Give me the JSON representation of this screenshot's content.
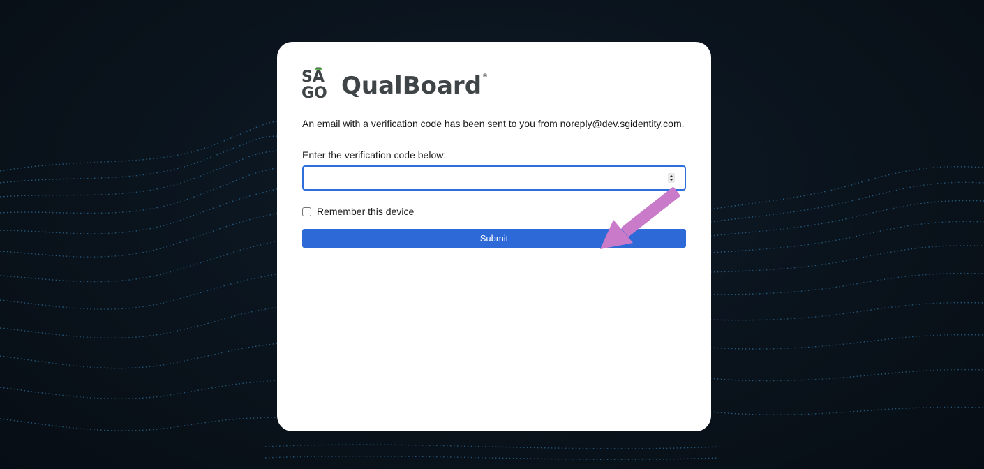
{
  "logo": {
    "sago_top": "SĀ",
    "sago_bottom": "GO",
    "brand_name": "QualBoard",
    "registered_mark": "®"
  },
  "verification": {
    "message": "An email with a verification code has been sent to you from noreply@dev.sgidentity.com.",
    "code_label": "Enter the verification code below:",
    "code_value": "",
    "remember_label": "Remember this device",
    "remember_checked": false,
    "submit_label": "Submit"
  },
  "colors": {
    "accent": "#2d6ad7",
    "input_focus_border": "#2f6fdc",
    "logo_green": "#5db54c",
    "annotation_arrow": "#c97ac9",
    "background": "#0a131c",
    "wave_dots": "#3a8fc8"
  }
}
